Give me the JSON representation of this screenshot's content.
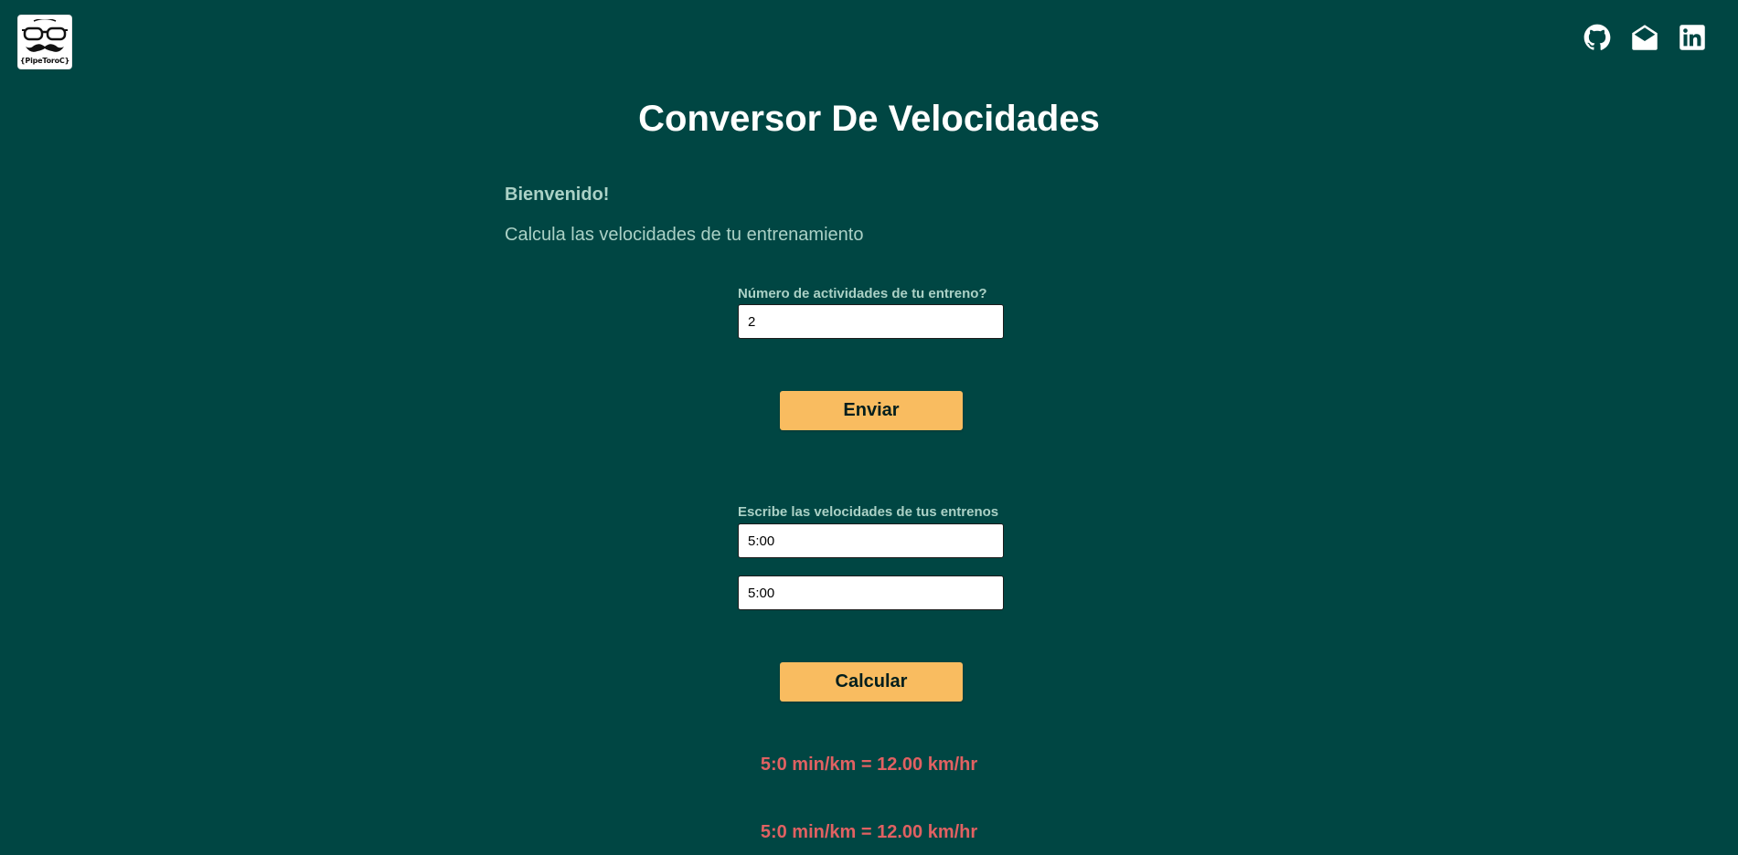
{
  "logo": {
    "text": "{PipeToroC}"
  },
  "social": [
    {
      "icon": "github-icon"
    },
    {
      "icon": "envelope-open-icon"
    },
    {
      "icon": "linkedin-icon"
    }
  ],
  "title": "Conversor De Velocidades",
  "intro": {
    "welcome": "Bienvenido!",
    "subtitle": "Calcula las velocidades de tu entrenamiento"
  },
  "activities": {
    "label": "Número de actividades de tu entreno?",
    "value": "2",
    "button": "Enviar"
  },
  "speeds": {
    "label": "Escribe las velocidades de tus entrenos",
    "inputs": [
      "5:00",
      "5:00"
    ],
    "button": "Calcular"
  },
  "results": [
    "5:0 min/km = 12.00 km/hr",
    "5:0 min/km = 12.00 km/hr"
  ],
  "colors": {
    "background": "#004643",
    "heading": "#fffffe",
    "text": "#abd1c6",
    "button": "#f9bc60",
    "result": "#e16162"
  }
}
